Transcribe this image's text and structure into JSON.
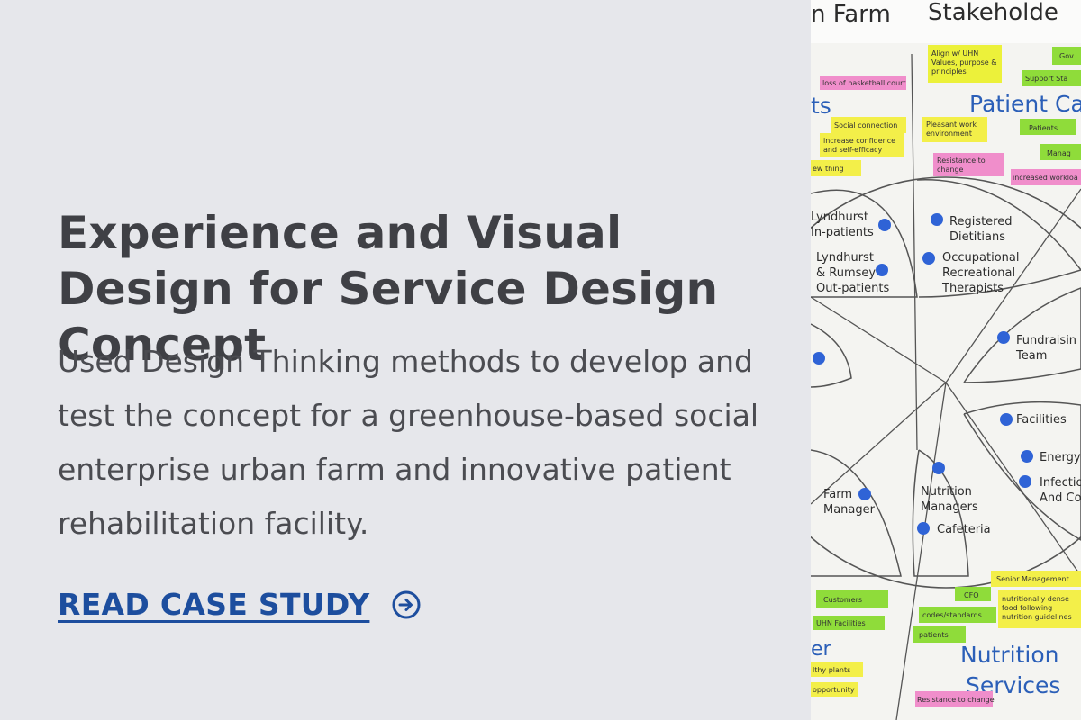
{
  "case": {
    "title": "Experience and Visual Design for Service Design Concept",
    "description": "Used Design Thinking methods to develop and test the concept for a greenhouse-based social enterprise urban farm and innovative patient rehabilitation facility.",
    "cta_label": "READ CASE STUDY",
    "cta_icon": "arrow-circle-right-icon"
  },
  "colors": {
    "background": "#e6e7eb",
    "title": "#3f4045",
    "body": "#4b4c51",
    "link": "#1d4e9e"
  },
  "photo": {
    "header_left": "n Farm",
    "header_right": "Stakeholde",
    "section_patient": "Patient Ca",
    "section_nutrition": "Nutrition",
    "section_services": "Services",
    "section_left_top": "ts",
    "section_left_bottom": "er",
    "stakeholders": {
      "lyndhurst_in": "Lyndhurst\nIn-patients",
      "lyndhurst_out": "Lyndhurst\n& Rumsey\nOut-patients",
      "dietitians": "Registered\nDietitians",
      "occupational": "Occupational\nRecreational\nTherapists",
      "fundraising": "Fundraisin\nTeam",
      "facilities": "Facilities",
      "energy": "Energy",
      "infection": "Infectio\nAnd Co",
      "farm_manager": "Farm\nManager",
      "nutrition_managers": "Nutrition\nManagers",
      "cafeteria": "Cafeteria"
    },
    "notes": {
      "align": "Align w/ UHN\nValues, purpose &\nprinciples",
      "gov": "Gov",
      "support": "Support Sta",
      "basketball": "loss of basketball court",
      "social": "Social connection",
      "confidence": "increase confidence\nand self-efficacy",
      "new_thing": "ew thing",
      "pleasant": "Pleasant work\nenvironment",
      "patients_top": "Patients",
      "manag": "Manag",
      "resistance_top": "Resistance to\nchange",
      "workload": "increased workloa",
      "customers": "Customers",
      "uhn_facilities": "UHN Facilities",
      "cfo": "CFO",
      "codes": "codes/standards",
      "senior": "Senior Management",
      "nutritional": "nutritionally dense\nfood following\nnutrition guidelines",
      "patients_bottom": "patients",
      "plants": "lthy plants",
      "opportunity": "opportunity",
      "resistance_bottom": "Resistance to change"
    }
  }
}
